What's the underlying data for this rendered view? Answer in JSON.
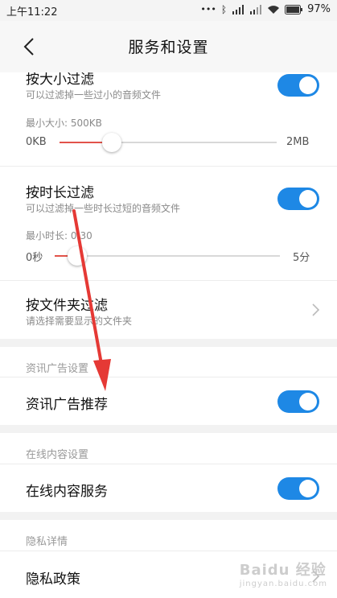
{
  "status": {
    "time": "上午11:22",
    "battery": "97%"
  },
  "header": {
    "title": "服务和设置"
  },
  "size_filter": {
    "title": "按大小过滤",
    "subtitle": "可以过滤掉一些过小的音频文件",
    "slider_label": "最小大小: 500KB",
    "min": "0KB",
    "max": "2MB",
    "value_fraction": 0.24
  },
  "duration_filter": {
    "title": "按时长过滤",
    "subtitle": "可以过滤掉一些时长过短的音频文件",
    "slider_label": "最小时长: 0:30",
    "min": "0秒",
    "max": "5分",
    "value_fraction": 0.1
  },
  "folder_filter": {
    "title": "按文件夹过滤",
    "subtitle": "请选择需要显示的文件夹"
  },
  "ad_section": {
    "header": "资讯广告设置",
    "item": "资讯广告推荐"
  },
  "online_section": {
    "header": "在线内容设置",
    "item": "在线内容服务"
  },
  "privacy_section": {
    "header": "隐私详情",
    "item": "隐私政策"
  },
  "watermark": {
    "text": "Baidu 经验",
    "sub": "jingyan.baidu.com"
  },
  "colors": {
    "accent": "#1e88e5",
    "slider": "#e2534a",
    "arrow": "#e53935"
  }
}
